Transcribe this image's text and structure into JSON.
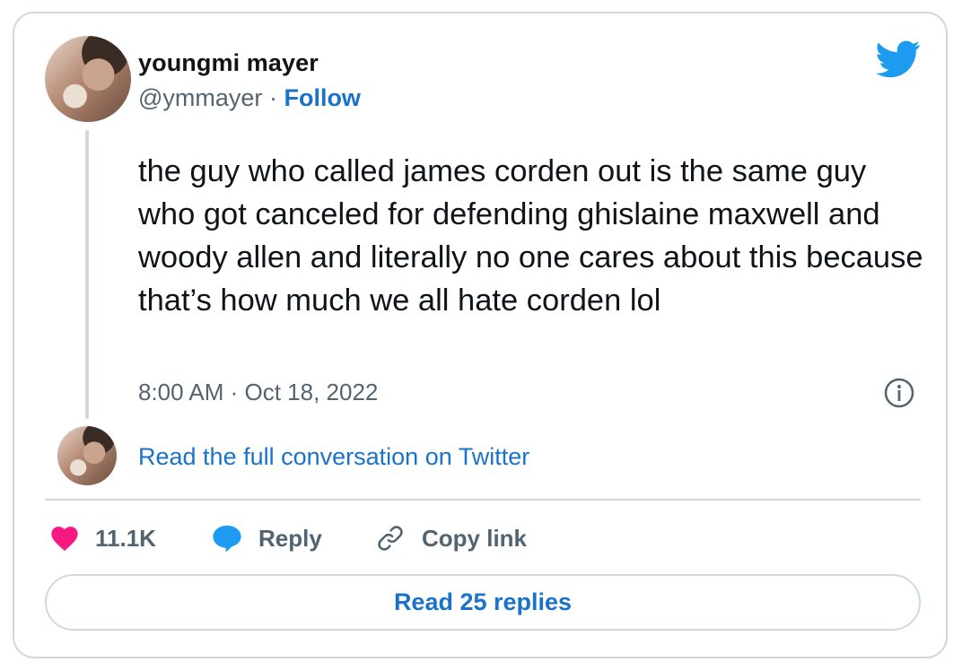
{
  "author": {
    "name": "youngmi mayer",
    "handle": "@ymmayer",
    "separator": "·",
    "follow_label": "Follow"
  },
  "tweet": {
    "text": "the guy who called james corden out is the same guy who got canceled for defending ghislaine maxwell and woody allen and literally no one cares about this because that’s how much we all hate corden lol",
    "timestamp": "8:00 AM · Oct 18, 2022"
  },
  "conversation_link": "Read the full conversation on Twitter",
  "actions": {
    "likes": "11.1K",
    "reply_label": "Reply",
    "copy_label": "Copy link"
  },
  "read_replies_label": "Read 25 replies",
  "colors": {
    "link": "#1a73c9",
    "like": "#f91880",
    "reply": "#1d9bf0",
    "bird": "#1d9bf0"
  },
  "icons": [
    "twitter-bird-icon",
    "info-icon",
    "heart-icon",
    "reply-bubble-icon",
    "link-icon"
  ]
}
